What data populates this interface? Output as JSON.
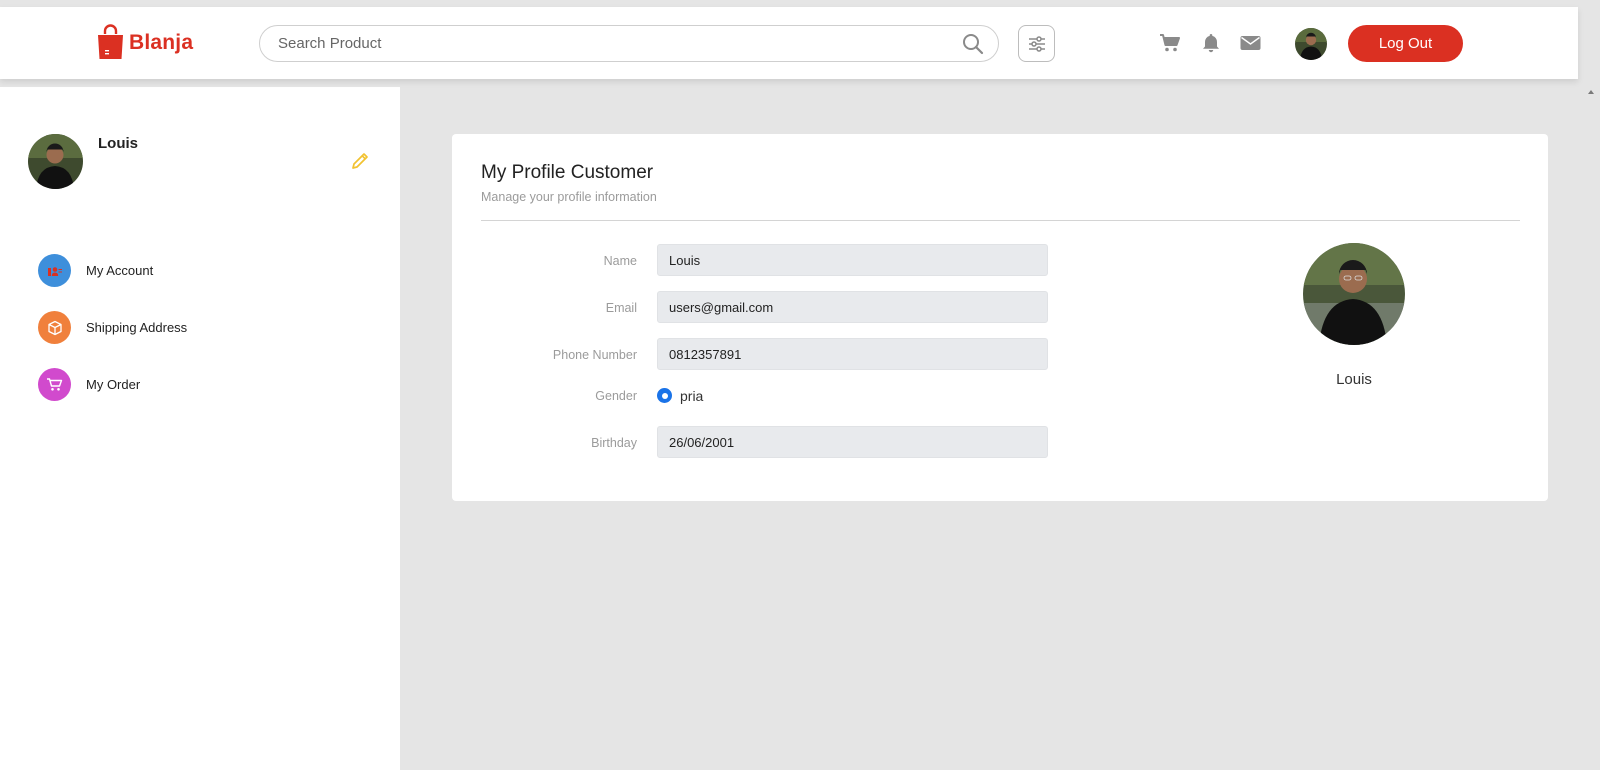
{
  "brand": {
    "name": "Blanja",
    "color": "#DB3022"
  },
  "search": {
    "placeholder": "Search Product",
    "icon": "search-icon"
  },
  "nav": {
    "filter_icon": "sliders-icon",
    "cart_icon": "cart-icon",
    "bell_icon": "bell-icon",
    "mail_icon": "mail-icon",
    "logout_label": "Log Out",
    "logout_color": "#DB3022"
  },
  "sidebar": {
    "username": "Louis",
    "edit_icon": "pencil-icon",
    "items": [
      {
        "label": "My Account",
        "icon": "user-icon",
        "color": "#3E8FDB"
      },
      {
        "label": "Shipping Address",
        "icon": "box-icon",
        "color": "#F0803C"
      },
      {
        "label": "My Order",
        "icon": "cart-icon",
        "color": "#D14ACD"
      }
    ]
  },
  "profile": {
    "title": "My Profile Customer",
    "subtitle": "Manage your profile information",
    "fields": [
      {
        "label": "Name",
        "value": "Louis"
      },
      {
        "label": "Email",
        "value": "users@gmail.com"
      },
      {
        "label": "Phone Number",
        "value": "0812357891"
      },
      {
        "label": "Gender",
        "value": "pria"
      },
      {
        "label": "Birthday",
        "value": "26/06/2001"
      }
    ],
    "avatar_name": "Louis"
  }
}
